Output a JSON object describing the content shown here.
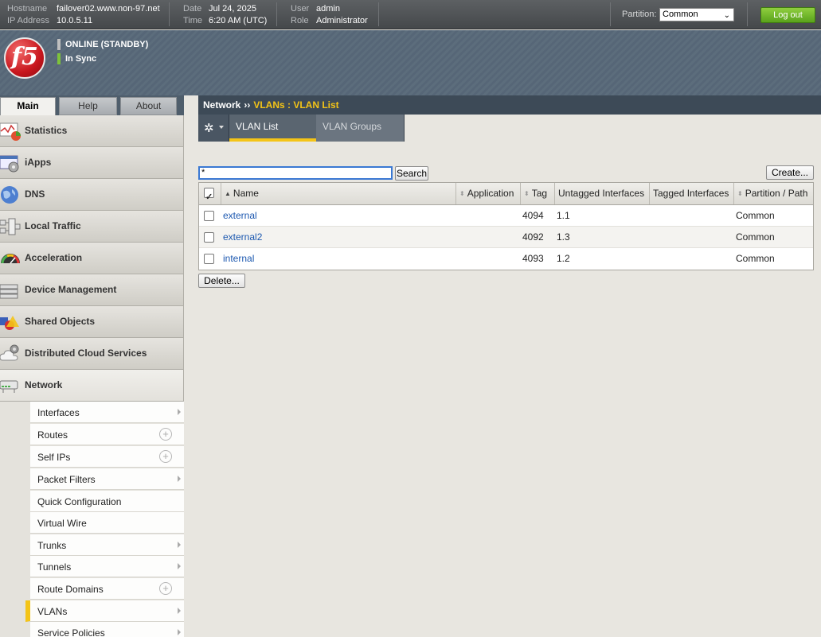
{
  "topbar": {
    "hostname_label": "Hostname",
    "hostname": "failover02.www.non-97.net",
    "ip_label": "IP Address",
    "ip": "10.0.5.11",
    "date_label": "Date",
    "date": "Jul 24, 2025",
    "time_label": "Time",
    "time": "6:20 AM (UTC)",
    "user_label": "User",
    "user": "admin",
    "role_label": "Role",
    "role": "Administrator",
    "partition_label": "Partition:",
    "partition_value": "Common",
    "logout": "Log out"
  },
  "header": {
    "logo": "f5",
    "status": "ONLINE (STANDBY)",
    "sync": "In Sync",
    "status_color": "#bfbfbf",
    "sync_color": "#7ec33a"
  },
  "main_tabs": [
    "Main",
    "Help",
    "About"
  ],
  "sidebar": {
    "items": [
      {
        "label": "Statistics",
        "icon": "statistics-icon"
      },
      {
        "label": "iApps",
        "icon": "iapps-icon"
      },
      {
        "label": "DNS",
        "icon": "dns-globe-icon"
      },
      {
        "label": "Local Traffic",
        "icon": "local-traffic-icon"
      },
      {
        "label": "Acceleration",
        "icon": "acceleration-gauge-icon"
      },
      {
        "label": "Device Management",
        "icon": "device-management-icon"
      },
      {
        "label": "Shared Objects",
        "icon": "shared-objects-icon"
      },
      {
        "label": "Distributed Cloud Services",
        "icon": "cloud-services-icon"
      },
      {
        "label": "Network",
        "icon": "network-icon"
      }
    ],
    "sub_items": [
      {
        "label": "Interfaces",
        "suffix": "arrow"
      },
      {
        "label": "Routes",
        "suffix": "plus"
      },
      {
        "label": "Self IPs",
        "suffix": "plus"
      },
      {
        "label": "Packet Filters",
        "suffix": "arrow"
      },
      {
        "label": "Quick Configuration",
        "suffix": "none"
      },
      {
        "label": "Virtual Wire",
        "suffix": "none"
      },
      {
        "label": "Trunks",
        "suffix": "arrow"
      },
      {
        "label": "Tunnels",
        "suffix": "arrow"
      },
      {
        "label": "Route Domains",
        "suffix": "plus"
      },
      {
        "label": "VLANs",
        "suffix": "arrow"
      },
      {
        "label": "Service Policies",
        "suffix": "arrow"
      }
    ],
    "active_sub": "VLANs"
  },
  "breadcrumb": {
    "section": "Network",
    "separator": "››",
    "current": "VLANs : VLAN List"
  },
  "subtabs": [
    "VLAN List",
    "VLAN Groups"
  ],
  "search": {
    "value": "*",
    "button": "Search"
  },
  "create_button": "Create...",
  "delete_button": "Delete...",
  "table": {
    "columns": [
      "Name",
      "Application",
      "Tag",
      "Untagged Interfaces",
      "Tagged Interfaces",
      "Partition / Path"
    ],
    "rows": [
      {
        "name": "external",
        "application": "",
        "tag": "4094",
        "untagged": "1.1",
        "tagged": "",
        "partition": "Common"
      },
      {
        "name": "external2",
        "application": "",
        "tag": "4092",
        "untagged": "1.3",
        "tagged": "",
        "partition": "Common"
      },
      {
        "name": "internal",
        "application": "",
        "tag": "4093",
        "untagged": "1.2",
        "tagged": "",
        "partition": "Common"
      }
    ]
  },
  "colors": {
    "accent": "#f4c417",
    "link": "#1c58b0",
    "logout": "#6ab42a"
  }
}
